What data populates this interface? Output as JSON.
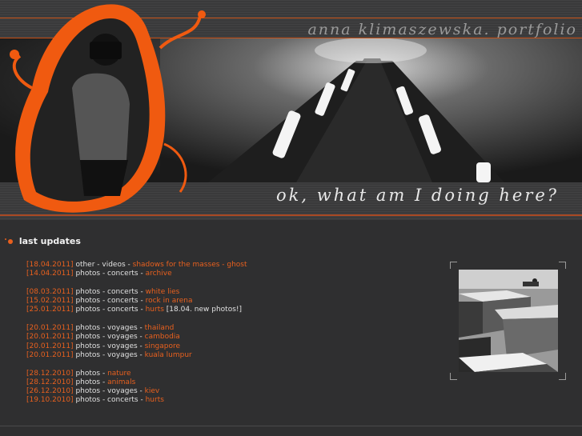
{
  "header": {
    "site_title": "anna klimaszewska. portfolio",
    "tagline": "ok,   what   am I   doing   here?"
  },
  "colors": {
    "accent": "#e8601e",
    "background": "#2f2f30",
    "text": "#e0e0e0"
  },
  "updates": {
    "heading": "last updates",
    "groups": [
      {
        "rows": [
          {
            "date": "[18.04.2011]",
            "path": "other - videos - ",
            "link": "shadows for the masses - ghost",
            "note": ""
          },
          {
            "date": "[14.04.2011]",
            "path": "photos - concerts - ",
            "link": "archive",
            "note": ""
          }
        ]
      },
      {
        "rows": [
          {
            "date": "[08.03.2011]",
            "path": "photos - concerts - ",
            "link": "white lies",
            "note": ""
          },
          {
            "date": "[15.02.2011]",
            "path": "photos - concerts - ",
            "link": "rock in arena",
            "note": ""
          },
          {
            "date": "[25.01.2011]",
            "path": "photos - concerts - ",
            "link": "hurts",
            "note": "[18.04. new photos!]"
          }
        ]
      },
      {
        "rows": [
          {
            "date": "[20.01.2011]",
            "path": "photos - voyages - ",
            "link": "thailand",
            "note": ""
          },
          {
            "date": "[20.01.2011]",
            "path": "photos - voyages - ",
            "link": "cambodia",
            "note": ""
          },
          {
            "date": "[20.01.2011]",
            "path": "photos - voyages - ",
            "link": "singapore",
            "note": ""
          },
          {
            "date": "[20.01.2011]",
            "path": "photos - voyages - ",
            "link": "kuala lumpur",
            "note": ""
          }
        ]
      },
      {
        "rows": [
          {
            "date": "[28.12.2010]",
            "path": "photos - ",
            "link": "nature",
            "note": ""
          },
          {
            "date": "[28.12.2010]",
            "path": "photos - ",
            "link": "animals",
            "note": ""
          },
          {
            "date": "[26.12.2010]",
            "path": "photos - voyages - ",
            "link": "kiev",
            "note": ""
          },
          {
            "date": "[19.10.2010]",
            "path": "photos - concerts - ",
            "link": "hurts",
            "note": ""
          }
        ]
      }
    ]
  }
}
